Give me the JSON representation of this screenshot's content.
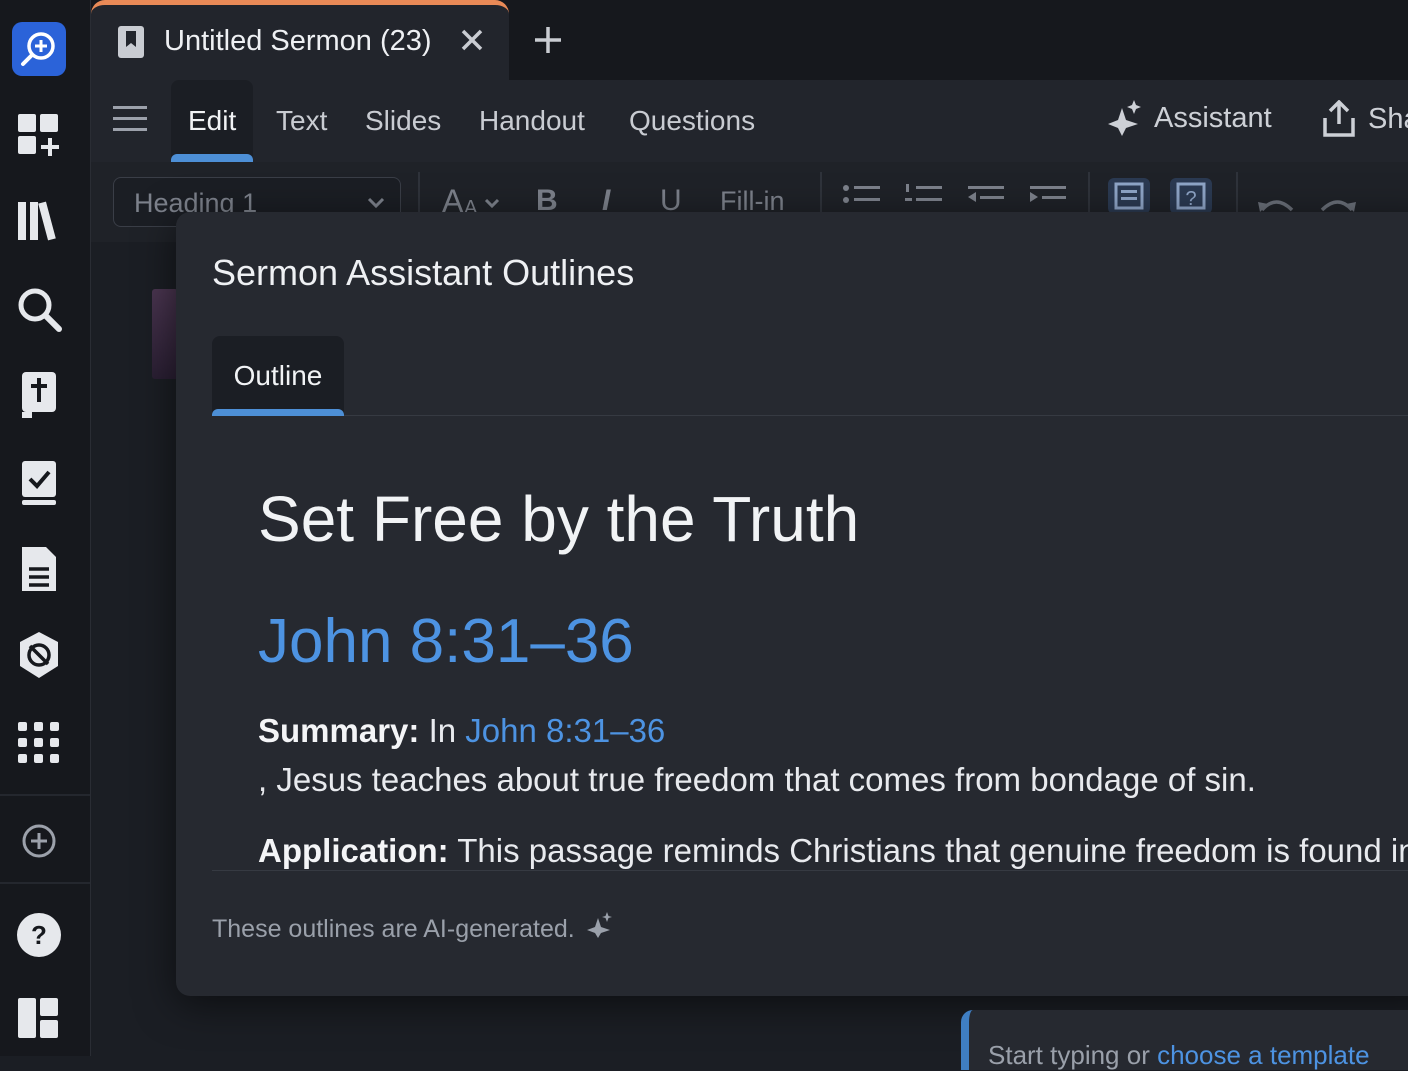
{
  "document_tab": {
    "title": "Untitled Sermon (23)"
  },
  "toolbar": {
    "tabs": [
      {
        "label": "Edit"
      },
      {
        "label": "Text"
      },
      {
        "label": "Slides"
      },
      {
        "label": "Handout"
      },
      {
        "label": "Questions"
      }
    ],
    "assistant_label": "Assistant",
    "share_label": "Sha"
  },
  "format_bar": {
    "style_select_value": "Heading 1",
    "bold": "B",
    "italic": "I",
    "underline": "U",
    "fill_in": "Fill-in"
  },
  "dialog": {
    "title": "Sermon Assistant Outlines",
    "tab_label": "Outline",
    "outline_title": "Set Free by the Truth",
    "outline_reference": "John 8:31–36",
    "summary_label": "Summary:",
    "summary_prefix": "In",
    "summary_link": "John 8:31–36",
    "summary_text": ", Jesus teaches about true freedom that comes from bondage of sin.",
    "application_label": "Application:",
    "application_text": "This passage reminds Christians that genuine freedom is found in",
    "footer_note": "These outlines are AI-generated."
  },
  "editor": {
    "placeholder_prefix": "Start typing or",
    "placeholder_link": "choose a template"
  },
  "colors": {
    "accent": "#4d8fd6",
    "link": "#4d93e2",
    "tab_highlight": "#e98a57",
    "background": "#1b1e24",
    "dialog_bg": "#262930"
  }
}
